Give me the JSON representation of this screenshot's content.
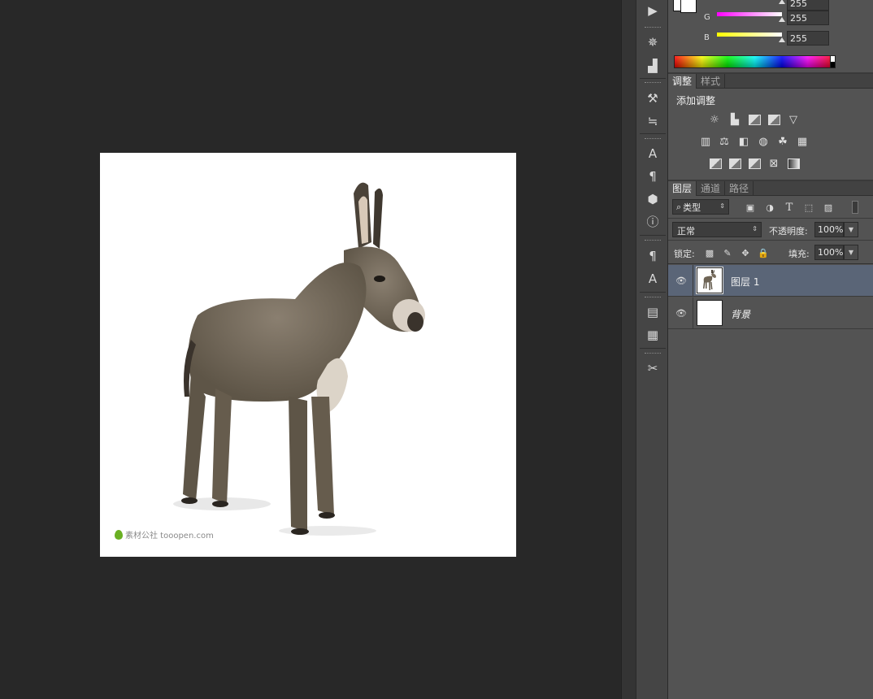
{
  "color_panel": {
    "r_value": "255",
    "g_label": "G",
    "g_value": "255",
    "b_label": "B",
    "b_value": "255"
  },
  "adjustments_panel": {
    "tabs": [
      {
        "label": "调整",
        "active": true
      },
      {
        "label": "样式",
        "active": false
      }
    ],
    "title": "添加调整"
  },
  "layers_panel": {
    "tabs": [
      {
        "label": "图层",
        "active": true
      },
      {
        "label": "通道",
        "active": false
      },
      {
        "label": "路径",
        "active": false
      }
    ],
    "kind_filter": "类型",
    "blend_mode": "正常",
    "opacity_label": "不透明度:",
    "opacity_value": "100%",
    "lock_label": "锁定:",
    "fill_label": "填充:",
    "fill_value": "100%",
    "layers": [
      {
        "name": "图层 1",
        "selected": true
      },
      {
        "name": "背景",
        "selected": false
      }
    ]
  },
  "canvas": {
    "watermark": "素材公社 tooopen.com"
  },
  "colors": {
    "workspace": "#282828",
    "panel": "#535353",
    "selected_layer": "#5a6577"
  }
}
